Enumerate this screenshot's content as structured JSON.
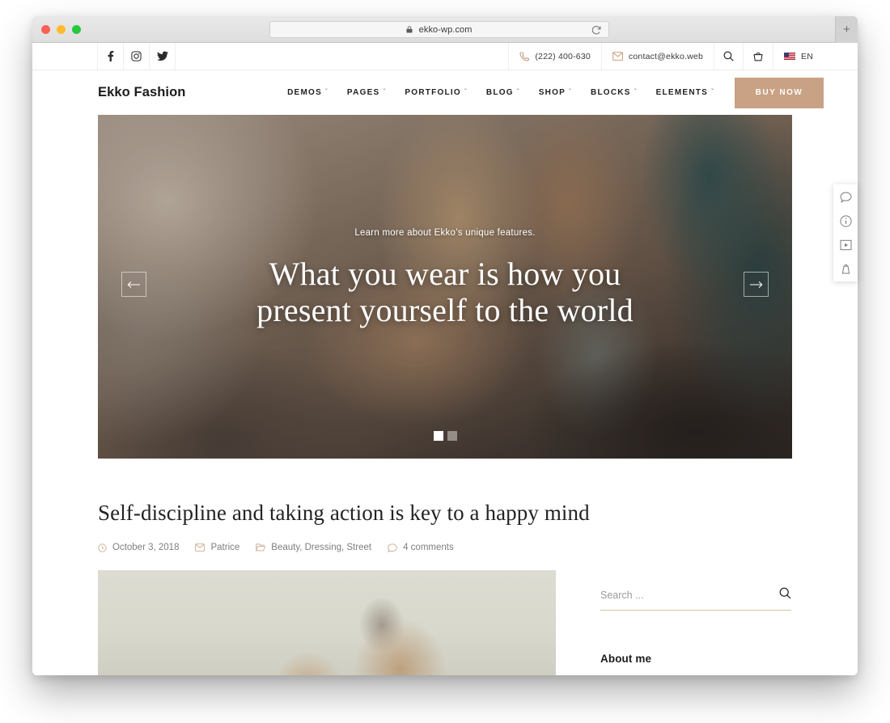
{
  "browser": {
    "url": "ekko-wp.com",
    "lock_icon": "lock-icon",
    "reload_icon": "reload-icon",
    "new_tab_label": "+"
  },
  "topbar": {
    "social": [
      {
        "name": "facebook-icon",
        "label": "f"
      },
      {
        "name": "instagram-icon",
        "label": ""
      },
      {
        "name": "twitter-icon",
        "label": ""
      }
    ],
    "phone": "(222) 400-630",
    "email": "contact@ekko.web",
    "search_icon": "search-icon",
    "cart_icon": "basket-icon",
    "language": "EN"
  },
  "header": {
    "logo": "Ekko Fashion",
    "nav": [
      {
        "label": "DEMOS",
        "caret": "ˇ"
      },
      {
        "label": "PAGES",
        "caret": "ˇ"
      },
      {
        "label": "PORTFOLIO",
        "caret": "ˇ"
      },
      {
        "label": "BLOG",
        "caret": "ˇ"
      },
      {
        "label": "SHOP",
        "caret": "ˇ"
      },
      {
        "label": "BLOCKS",
        "caret": "ˇ"
      },
      {
        "label": "ELEMENTS",
        "caret": "ˇ"
      }
    ],
    "cta_label": "BUY NOW",
    "cta_color": "#c9a184"
  },
  "hero": {
    "subtitle": "Learn more about Ekko’s unique features.",
    "title_line1": "What you wear is how you",
    "title_line2": "present yourself to the world",
    "prev_arrow": "←",
    "next_arrow": "→",
    "slides_total": 2,
    "active_slide": 1
  },
  "post": {
    "title": "Self-discipline and taking action is key to a happy mind",
    "meta": {
      "date": "October 3, 2018",
      "author": "Patrice",
      "categories": "Beauty, Dressing, Street",
      "comments": "4 comments"
    }
  },
  "sidebar": {
    "search_placeholder": "Search ...",
    "search_value": "",
    "about_heading": "About me"
  },
  "side_toolbar": [
    {
      "name": "chat-bubble-icon"
    },
    {
      "name": "info-circle-icon"
    },
    {
      "name": "video-box-icon"
    },
    {
      "name": "bag-icon"
    }
  ],
  "theme": {
    "accent": "#c9a184",
    "accent_light": "#d8c0aa",
    "text_dark": "#1c1c1c",
    "text_muted": "#7e7e7e"
  }
}
